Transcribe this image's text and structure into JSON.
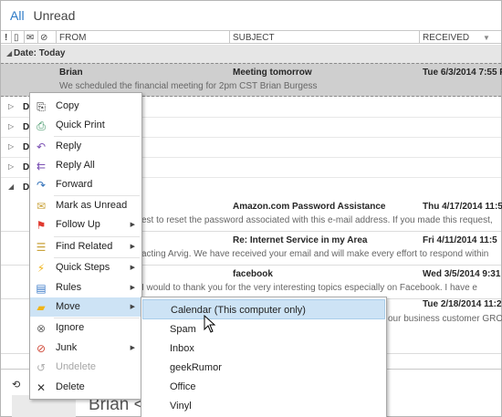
{
  "filter": {
    "all": "All",
    "unread": "Unread"
  },
  "columns": {
    "icons": "! 🗎 ✉ 📎",
    "from": "FROM",
    "subject": "SUBJECT",
    "received": "RECEIVED"
  },
  "group_today": "Date: Today",
  "collapsed_rows": [
    "D",
    "D",
    "D",
    "D",
    "D"
  ],
  "messages": [
    {
      "from": "Brian",
      "subject": "Meeting tomorrow",
      "received": "Tue 6/3/2014 7:55 P",
      "preview": "We scheduled the financial meeting for 2pm CST  Brian Burgess"
    },
    {
      "from": "",
      "subject": "Amazon.com Password Assistance",
      "received": "Thu 4/17/2014 11:5",
      "preview": "est to reset the password associated with this e-mail address. If you made this request,"
    },
    {
      "from": "",
      "subject": "Re: Internet Service in my Area",
      "received": "Fri 4/11/2014 11:5",
      "preview": "acting Arvig.  We have received your email and will make every effort to respond within"
    },
    {
      "from": "",
      "subject": "facebook",
      "received": "Wed 3/5/2014 9:31",
      "preview": "I would to thank you for the very interesting topics especially on Facebook.  I have e"
    },
    {
      "from": "",
      "subject": "",
      "received": "Tue 2/18/2014 11:2",
      "preview": "our business customer GRO"
    }
  ],
  "reading": {
    "sender_name": "Brian <"
  },
  "menu": {
    "copy": "Copy",
    "quick_print": "Quick Print",
    "reply": "Reply",
    "reply_all": "Reply All",
    "forward": "Forward",
    "mark_unread": "Mark as Unread",
    "follow_up": "Follow Up",
    "find_related": "Find Related",
    "quick_steps": "Quick Steps",
    "rules": "Rules",
    "move": "Move",
    "ignore": "Ignore",
    "junk": "Junk",
    "undelete": "Undelete",
    "delete": "Delete"
  },
  "move_submenu": [
    "Calendar (This computer only)",
    "Spam",
    "Inbox",
    "geekRumor",
    "Office",
    "Vinyl"
  ],
  "colors": {
    "accent": "#2b79c6",
    "highlight": "#cde3f5",
    "follow_flag": "#e03a2f",
    "quick_steps": "#f0b418",
    "rules": "#3a7ac8",
    "move": "#f0b418"
  }
}
